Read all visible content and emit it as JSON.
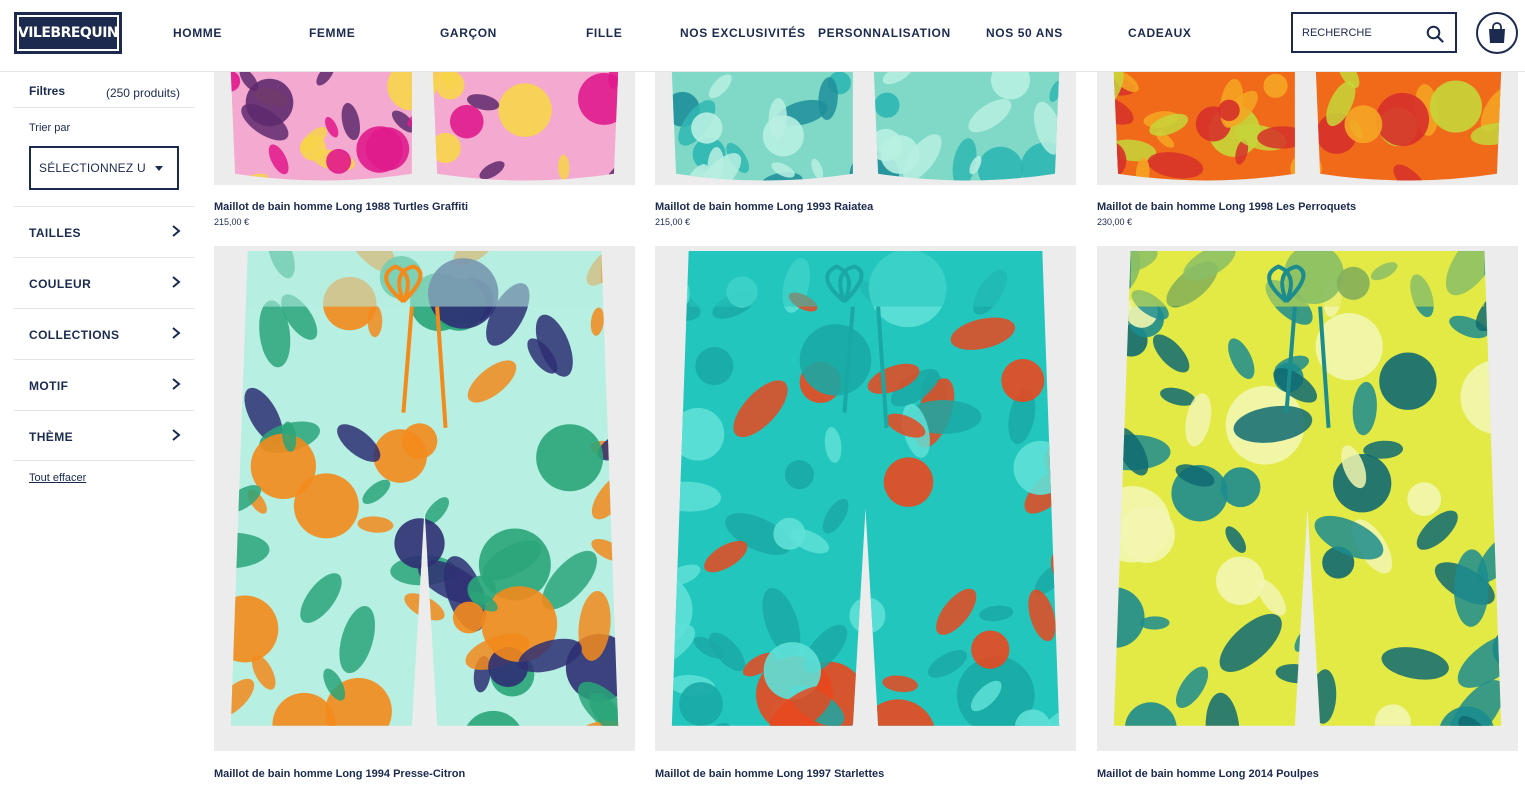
{
  "header": {
    "logo_text": "VILEBREQUIN",
    "nav": [
      "HOMME",
      "FEMME",
      "GARÇON",
      "FILLE",
      "NOS EXCLUSIVITÉS",
      "PERSONNALISATION",
      "NOS 50 ANS",
      "CADEAUX"
    ],
    "search_placeholder": "RECHERCHE",
    "icons": {
      "search": "search-icon",
      "cart": "shopping-bag-icon"
    }
  },
  "sidebar": {
    "filters_title": "Filtres",
    "product_count": "(250 produits)",
    "sort_label": "Trier par",
    "sort_value": "SÉLECTIONNEZ U",
    "filters": [
      "TAILLES",
      "COULEUR",
      "COLLECTIONS",
      "MOTIF",
      "THÈME"
    ],
    "clear_all": "Tout effacer"
  },
  "products": [
    {
      "name": "Maillot de bain homme Long 1988 Turtles Graffiti",
      "price": "215,00 €",
      "colors": [
        "#f4a9d0",
        "#e0198c",
        "#f7d54a",
        "#5f2a6e"
      ]
    },
    {
      "name": "Maillot de bain homme Long 1993 Raiatea",
      "price": "215,00 €",
      "colors": [
        "#7fd9c6",
        "#2fb6b2",
        "#b8efe2",
        "#1f8e9a"
      ]
    },
    {
      "name": "Maillot de bain homme Long 1998 Les Perroquets",
      "price": "230,00 €",
      "colors": [
        "#f06a1a",
        "#f5a623",
        "#c7d63a",
        "#d6302a"
      ]
    },
    {
      "name": "Maillot de bain homme Long 1994 Presse-Citron",
      "price": "",
      "colors": [
        "#b7efe2",
        "#f38a1c",
        "#2e2f73",
        "#2aa579"
      ]
    },
    {
      "name": "Maillot de bain homme Long 1997 Starlettes",
      "price": "",
      "colors": [
        "#22c6bd",
        "#1aa8a4",
        "#e8481e",
        "#5ee0d7"
      ]
    },
    {
      "name": "Maillot de bain homme Long 2014 Poulpes",
      "price": "",
      "colors": [
        "#e3ea45",
        "#1c8c8e",
        "#0f6a72",
        "#f2f6b0"
      ]
    }
  ]
}
